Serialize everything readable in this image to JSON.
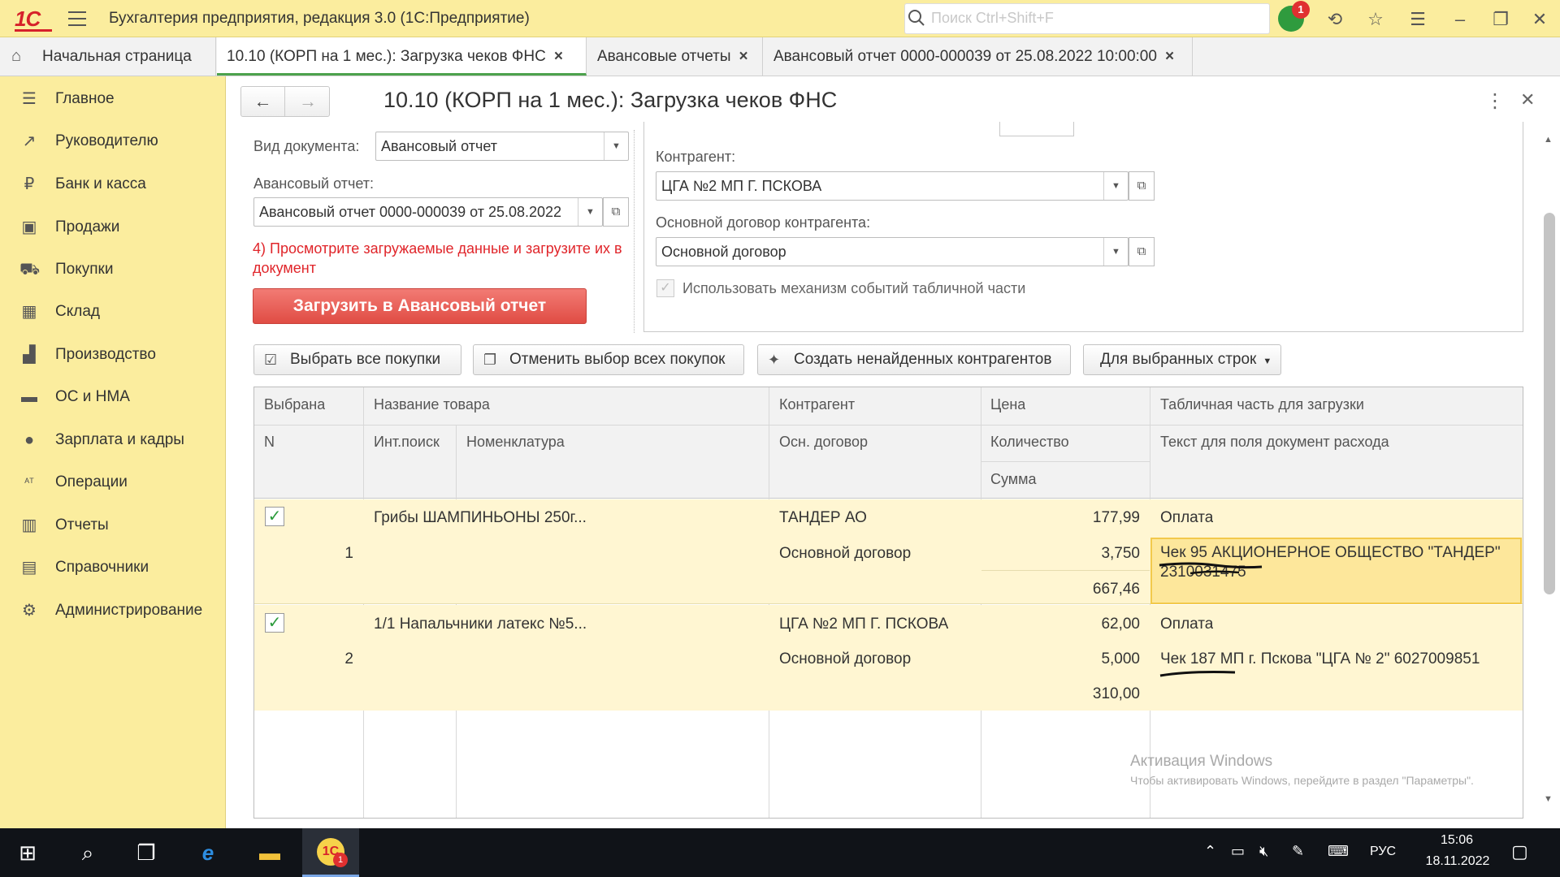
{
  "titlebar": {
    "logo": "1С",
    "title": "Бухгалтерия предприятия, редакция 3.0  (1С:Предприятие)",
    "search_placeholder": "Поиск Ctrl+Shift+F",
    "notification_count": "1"
  },
  "tabs": [
    {
      "label": "Начальная страница"
    },
    {
      "label": "10.10 (КОРП на 1 мес.): Загрузка чеков ФНС"
    },
    {
      "label": "Авансовые отчеты"
    },
    {
      "label": "Авансовый отчет 0000-000039 от 25.08.2022 10:00:00"
    }
  ],
  "sidebar": {
    "items": [
      {
        "label": "Главное",
        "icon": "menu-icon"
      },
      {
        "label": "Руководителю",
        "icon": "trend-icon"
      },
      {
        "label": "Банк и касса",
        "icon": "coin-icon"
      },
      {
        "label": "Продажи",
        "icon": "bag-icon"
      },
      {
        "label": "Покупки",
        "icon": "cart-icon"
      },
      {
        "label": "Склад",
        "icon": "warehouse-icon"
      },
      {
        "label": "Производство",
        "icon": "factory-icon"
      },
      {
        "label": "ОС и НМА",
        "icon": "truck-icon"
      },
      {
        "label": "Зарплата и кадры",
        "icon": "person-icon"
      },
      {
        "label": "Операции",
        "icon": "operations-icon"
      },
      {
        "label": "Отчеты",
        "icon": "chart-icon"
      },
      {
        "label": "Справочники",
        "icon": "book-icon"
      },
      {
        "label": "Администрирование",
        "icon": "gear-icon"
      }
    ]
  },
  "form": {
    "title": "10.10 (КОРП на 1 мес.): Загрузка чеков ФНС",
    "doc_type_label": "Вид документа:",
    "doc_type_value": "Авансовый отчет",
    "advance_label": "Авансовый отчет:",
    "advance_value": "Авансовый отчет 0000-000039 от 25.08.2022",
    "instruction": "4) Просмотрите загружаемые данные и загрузите их в документ",
    "load_button": "Загрузить в Авансовый отчет",
    "counterparty_label": "Контрагент:",
    "counterparty_value": "ЦГА №2 МП Г. ПСКОВА",
    "contract_label": "Основной договор контрагента:",
    "contract_value": "Основной договор",
    "events_checkbox_label": "Использовать механизм событий табличной части",
    "events_checkbox_checked": true
  },
  "commands": {
    "select_all": "Выбрать все покупки",
    "unselect_all": "Отменить выбор всех покупок",
    "create_counterparties": "Создать ненайденных контрагентов",
    "for_selected": "Для выбранных строк"
  },
  "table": {
    "headers": {
      "selected": "Выбрана",
      "n": "N",
      "product_name": "Название товара",
      "int_search": "Инт.поиск",
      "nomenclature": "Номенклатура",
      "counterparty": "Контрагент",
      "contract": "Осн. договор",
      "price": "Цена",
      "quantity": "Количество",
      "sum": "Сумма",
      "tab_part": "Табличная часть для загрузки",
      "expense_text": "Текст для поля документ расхода"
    },
    "rows": [
      {
        "checked": true,
        "n": "1",
        "product": "Грибы ШАМПИНЬОНЫ 250г...",
        "counterparty": "ТАНДЕР АО",
        "contract": "Основной договор",
        "price": "177,99",
        "quantity": "3,750",
        "sum": "667,46",
        "tab_part": "Оплата",
        "text": "Чек 95 АКЦИОНЕРНОЕ ОБЩЕСТВО \"ТАНДЕР\" 2310031475"
      },
      {
        "checked": true,
        "n": "2",
        "product": "1/1 Напальчники латекс №5...",
        "counterparty": "ЦГА №2 МП Г. ПСКОВА",
        "contract": "Основной договор",
        "price": "62,00",
        "quantity": "5,000",
        "sum": "310,00",
        "tab_part": "Оплата",
        "text": "Чек 187 МП г. Пскова \"ЦГА № 2\" 6027009851"
      }
    ]
  },
  "watermark": {
    "line1": "Активация Windows",
    "line2": "Чтобы активировать Windows, перейдите в раздел \"Параметры\"."
  },
  "taskbar": {
    "lang": "РУС",
    "time": "15:06",
    "date": "18.11.2022",
    "app_badge": "1"
  }
}
